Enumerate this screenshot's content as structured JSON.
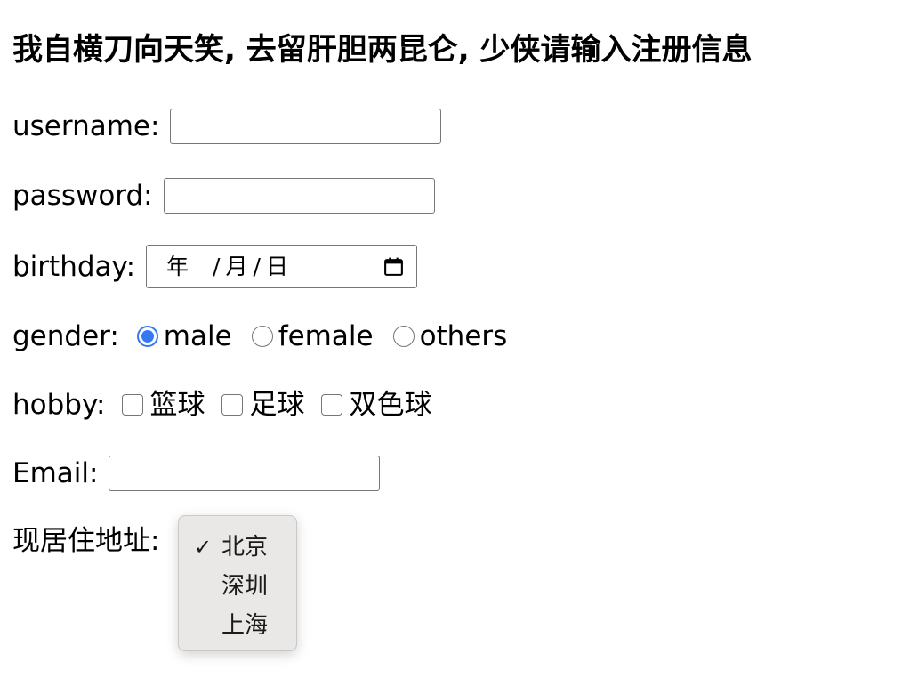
{
  "heading": "我自横刀向天笑, 去留肝胆两昆仑, 少侠请输入注册信息",
  "form": {
    "username": {
      "label": "username:",
      "value": ""
    },
    "password": {
      "label": "password:",
      "value": ""
    },
    "birthday": {
      "label": "birthday:",
      "year": "年",
      "sep1": "/",
      "month": "月",
      "sep2": "/",
      "day": "日",
      "icon": "calendar-icon"
    },
    "gender": {
      "label": "gender:",
      "options": [
        {
          "label": "male",
          "checked": true
        },
        {
          "label": "female",
          "checked": false
        },
        {
          "label": "others",
          "checked": false
        }
      ]
    },
    "hobby": {
      "label": "hobby:",
      "options": [
        {
          "label": "篮球",
          "checked": false
        },
        {
          "label": "足球",
          "checked": false
        },
        {
          "label": "双色球",
          "checked": false
        }
      ]
    },
    "email": {
      "label": "Email:",
      "value": ""
    },
    "address": {
      "label": "现居住地址:",
      "selected": "北京",
      "options": [
        "北京",
        "深圳",
        "上海"
      ],
      "check_mark": "✓"
    }
  },
  "colors": {
    "accent": "#3478f6",
    "border": "#767676",
    "dropdown_bg": "#e9e8e6"
  }
}
